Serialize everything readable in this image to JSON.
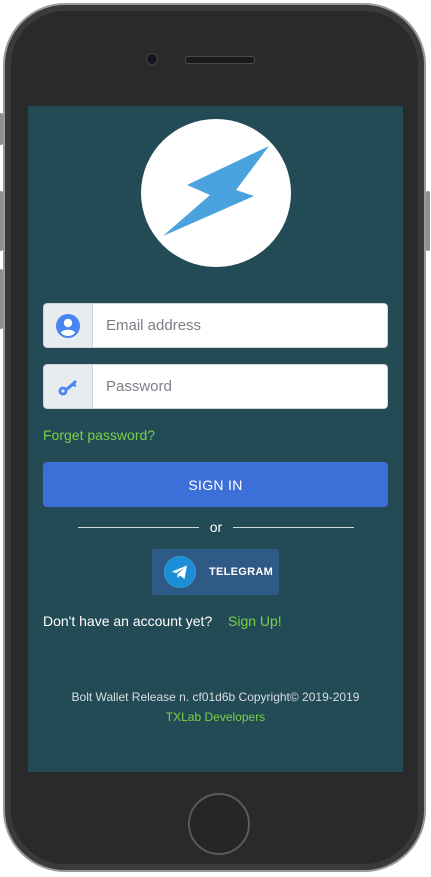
{
  "login": {
    "email_placeholder": "Email address",
    "password_placeholder": "Password",
    "forgot_password": "Forget password?",
    "sign_in": "SIGN IN",
    "or": "or",
    "telegram": "TELEGRAM",
    "no_account": "Don't have an account yet?",
    "sign_up": "Sign Up!"
  },
  "footer": {
    "release": "Bolt Wallet Release n. cf01d6b Copyright© 2019-2019",
    "developers": "TXLab Developers"
  },
  "icons": {
    "logo": "lightning-bolt-icon",
    "email": "user-circle-icon",
    "password": "key-icon",
    "telegram": "telegram-icon"
  },
  "colors": {
    "screen_background": "#234b56",
    "primary_button": "#3d6fd9",
    "link_green": "#7bcf4a",
    "telegram_button": "#2f5a85",
    "logo_bolt": "#4aa3df"
  }
}
